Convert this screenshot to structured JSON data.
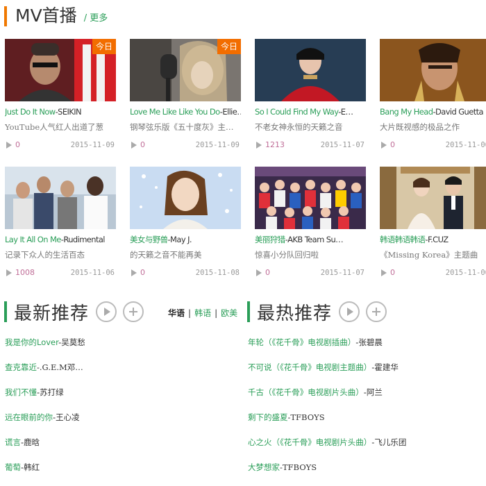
{
  "mv_section": {
    "title": "MV首播",
    "more_label": "/ 更多",
    "colors": {
      "accent_bar": "#f07800",
      "badge": "#f26d00",
      "link": "#2a9e58"
    },
    "items": [
      {
        "song": "Just Do It Now",
        "artist": "-SEIKIN",
        "desc": "YouTube人气红人出道了葱",
        "plays": "0",
        "date": "2015-11-09",
        "badge": "今日",
        "thumb": "artist-red-dark"
      },
      {
        "song": "Love Me Like Like You Do",
        "artist": "-Ellie…",
        "desc": "钢琴弦乐版《五十度灰》主…",
        "plays": "0",
        "date": "2015-11-09",
        "badge": "今日",
        "thumb": "singer-microphone"
      },
      {
        "song": "So I Could Find My Way",
        "artist": "-E…",
        "desc": "不老女神永恒的天籁之音",
        "plays": "1213",
        "date": "2015-11-07",
        "badge": "",
        "thumb": "woman-red-dress"
      },
      {
        "song": "Bang My Head",
        "artist": "-David Guetta",
        "desc": "大片既视感的极品之作",
        "plays": "0",
        "date": "2015-11-06",
        "badge": "",
        "thumb": "warrior-woman"
      },
      {
        "song": "Lay It All On Me",
        "artist": "-Rudimental",
        "desc": "记录下众人的生活百态",
        "plays": "1008",
        "date": "2015-11-06",
        "badge": "",
        "thumb": "band-group"
      },
      {
        "song": "美女与野兽",
        "artist": "-May J.",
        "desc": "的天籁之音不能再美",
        "plays": "0",
        "date": "2015-11-08",
        "badge": "",
        "thumb": "girl-stars"
      },
      {
        "song": "美丽狩猎",
        "artist": "-AKB Team Su…",
        "desc": "惊喜小分队回归啦",
        "plays": "0",
        "date": "2015-11-07",
        "badge": "",
        "thumb": "idol-group"
      },
      {
        "song": "韩语韩语韩语",
        "artist": "-F.CUZ",
        "desc": "《Missing Korea》主题曲",
        "plays": "0",
        "date": "2015-11-06",
        "badge": "",
        "thumb": "couple-hall"
      }
    ]
  },
  "latest_section": {
    "title": "最新推荐",
    "play_icon": "play-circle-icon",
    "add_icon": "plus-circle-icon",
    "tabs": [
      {
        "label": "华语",
        "state": "active"
      },
      {
        "label": "韩语",
        "state": "normal"
      },
      {
        "label": "欧美",
        "state": "normal"
      }
    ],
    "tab_separator": "|",
    "songs": [
      {
        "name": "我是你的Lover",
        "artist": "-吴莫愁"
      },
      {
        "name": "查克靠近",
        "artist": "-.G.E.M邓…"
      },
      {
        "name": "我们不懂",
        "artist": "-苏打绿"
      },
      {
        "name": "远在眼前的你",
        "artist": "-王心凌"
      },
      {
        "name": "谎言",
        "artist": "-鹿晗"
      },
      {
        "name": "葡萄",
        "artist": "-韩红"
      }
    ]
  },
  "hot_section": {
    "title": "最热推荐",
    "play_icon": "play-circle-icon",
    "add_icon": "plus-circle-icon",
    "songs": [
      {
        "name": "年轮（《花千骨》电视剧插曲）",
        "artist": "-张碧晨"
      },
      {
        "name": "不可说（《花千骨》电视剧主题曲）",
        "artist": "-霍建华"
      },
      {
        "name": "千古（《花千骨》电视剧片头曲）",
        "artist": "-阿兰"
      },
      {
        "name": "剩下的盛夏",
        "artist": "-TFBOYS"
      },
      {
        "name": "心之火（《花千骨》电视剧片头曲）",
        "artist": "-飞儿乐团"
      },
      {
        "name": "大梦想家",
        "artist": "-TFBOYS"
      }
    ]
  }
}
